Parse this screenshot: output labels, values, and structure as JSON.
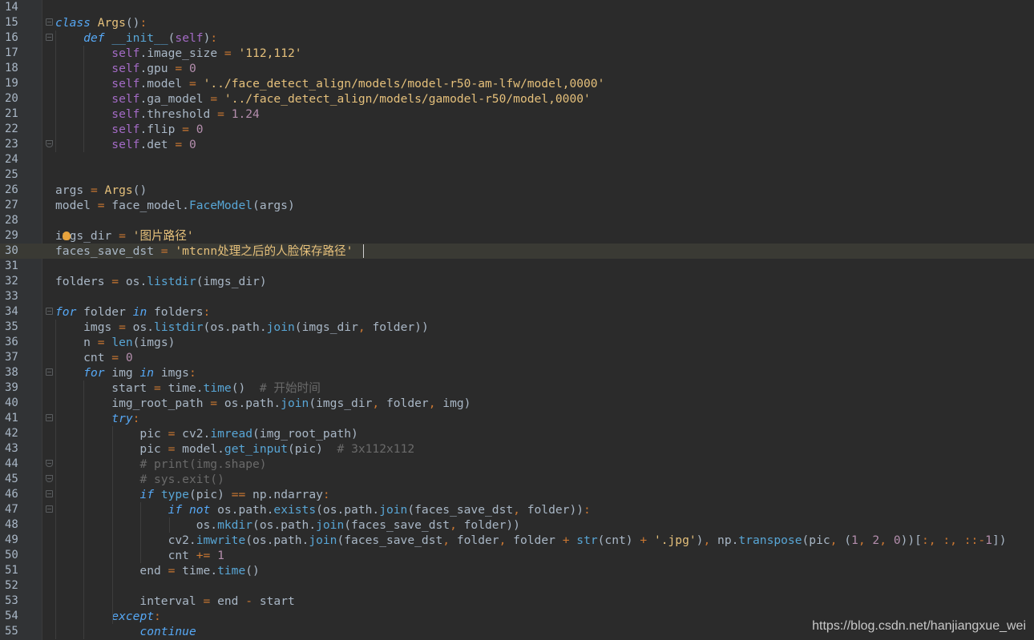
{
  "editor": {
    "language": "python",
    "current_line": 30,
    "colors": {
      "background": "#2b2b2b",
      "gutter": "#313335",
      "current_line": "#3a3a34",
      "keyword": "#56a8f5",
      "string": "#e5c07b",
      "number": "#b48ead",
      "self": "#a46bc6",
      "comment": "#6a6a6a"
    },
    "lines": [
      {
        "n": "14",
        "text": ""
      },
      {
        "n": "15",
        "text": "class Args():"
      },
      {
        "n": "16",
        "text": "    def __init__(self):"
      },
      {
        "n": "17",
        "text": "        self.image_size = '112,112'"
      },
      {
        "n": "18",
        "text": "        self.gpu = 0"
      },
      {
        "n": "19",
        "text": "        self.model = '../face_detect_align/models/model-r50-am-lfw/model,0000'"
      },
      {
        "n": "20",
        "text": "        self.ga_model = '../face_detect_align/models/gamodel-r50/model,0000'"
      },
      {
        "n": "21",
        "text": "        self.threshold = 1.24"
      },
      {
        "n": "22",
        "text": "        self.flip = 0"
      },
      {
        "n": "23",
        "text": "        self.det = 0"
      },
      {
        "n": "24",
        "text": ""
      },
      {
        "n": "25",
        "text": ""
      },
      {
        "n": "26",
        "text": "args = Args()"
      },
      {
        "n": "27",
        "text": "model = face_model.FaceModel(args)"
      },
      {
        "n": "28",
        "text": ""
      },
      {
        "n": "29",
        "text": "imgs_dir = '图片路径'"
      },
      {
        "n": "30",
        "text": "faces_save_dst = 'mtcnn处理之后的人脸保存路径'"
      },
      {
        "n": "31",
        "text": ""
      },
      {
        "n": "32",
        "text": "folders = os.listdir(imgs_dir)"
      },
      {
        "n": "33",
        "text": ""
      },
      {
        "n": "34",
        "text": "for folder in folders:"
      },
      {
        "n": "35",
        "text": "    imgs = os.listdir(os.path.join(imgs_dir, folder))"
      },
      {
        "n": "36",
        "text": "    n = len(imgs)"
      },
      {
        "n": "37",
        "text": "    cnt = 0"
      },
      {
        "n": "38",
        "text": "    for img in imgs:"
      },
      {
        "n": "39",
        "text": "        start = time.time()  # 开始时间"
      },
      {
        "n": "40",
        "text": "        img_root_path = os.path.join(imgs_dir, folder, img)"
      },
      {
        "n": "41",
        "text": "        try:"
      },
      {
        "n": "42",
        "text": "            pic = cv2.imread(img_root_path)"
      },
      {
        "n": "43",
        "text": "            pic = model.get_input(pic)  # 3x112x112"
      },
      {
        "n": "44",
        "text": "            # print(img.shape)"
      },
      {
        "n": "45",
        "text": "            # sys.exit()"
      },
      {
        "n": "46",
        "text": "            if type(pic) == np.ndarray:"
      },
      {
        "n": "47",
        "text": "                if not os.path.exists(os.path.join(faces_save_dst, folder)):"
      },
      {
        "n": "48",
        "text": "                    os.mkdir(os.path.join(faces_save_dst, folder))"
      },
      {
        "n": "49",
        "text": "                cv2.imwrite(os.path.join(faces_save_dst, folder, folder + str(cnt) + '.jpg'), np.transpose(pic, (1, 2, 0))[:, :, ::-1])"
      },
      {
        "n": "50",
        "text": "                cnt += 1"
      },
      {
        "n": "51",
        "text": "            end = time.time()"
      },
      {
        "n": "52",
        "text": ""
      },
      {
        "n": "53",
        "text": "            interval = end - start"
      },
      {
        "n": "54",
        "text": "        except:"
      },
      {
        "n": "55",
        "text": "            continue"
      }
    ]
  },
  "watermark": "https://blog.csdn.net/hanjiangxue_wei"
}
